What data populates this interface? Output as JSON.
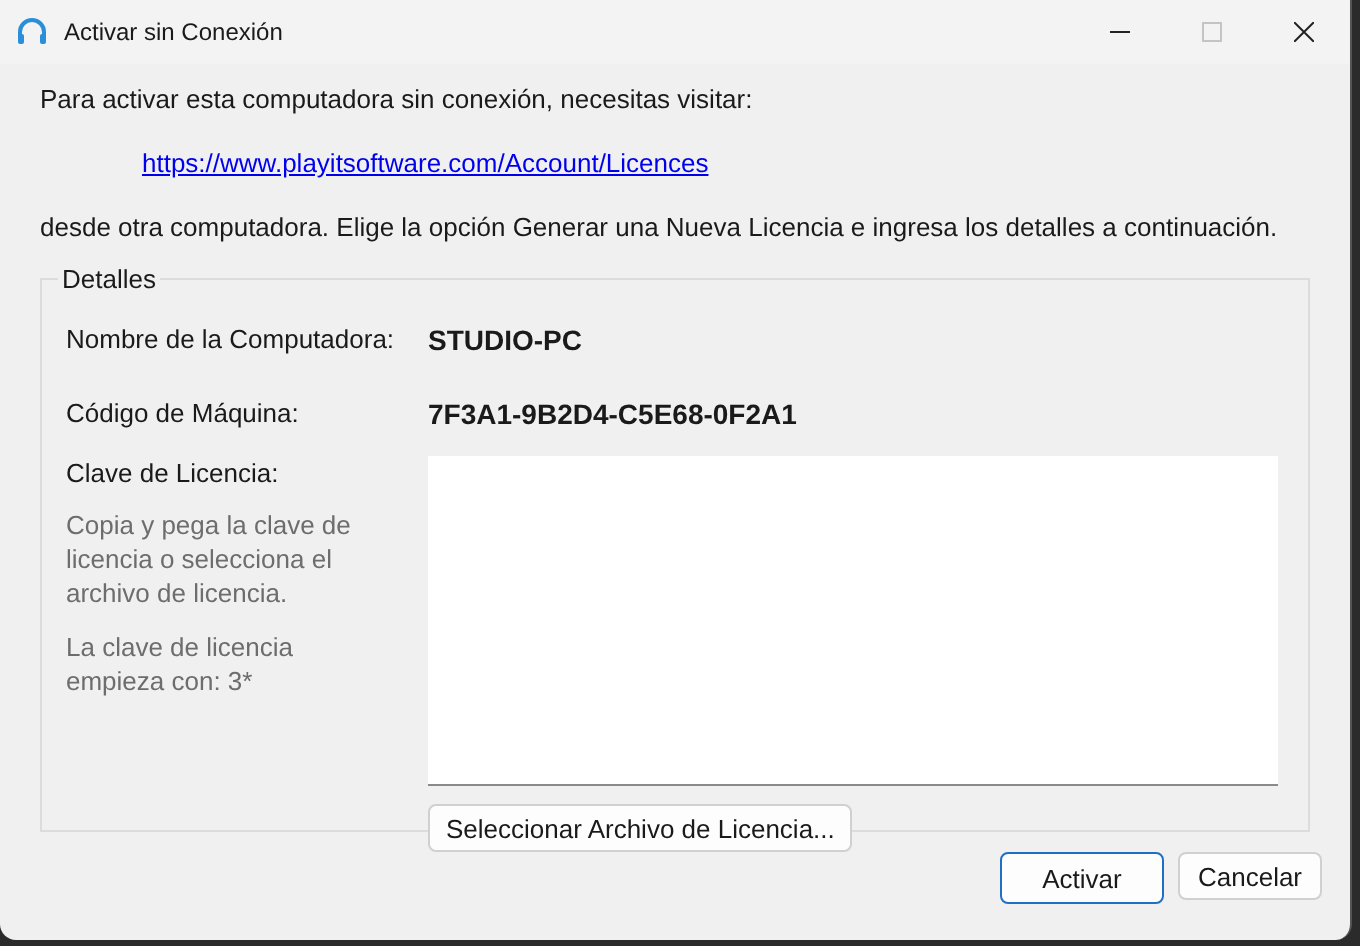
{
  "window": {
    "title": "Activar sin Conexión",
    "maximize_disabled": true
  },
  "intro": "Para activar esta computadora sin conexión, necesitas visitar:",
  "link": "https://www.playitsoftware.com/Account/Licences",
  "instructions": "desde otra computadora. Elige la opción Generar una Nueva Licencia e ingresa los detalles a continuación.",
  "details": {
    "title": "Detalles",
    "fields": [
      {
        "label": "Nombre de la Computadora:",
        "value": "STUDIO-PC"
      },
      {
        "label": "Código de Máquina:",
        "value": "7F3A1-9B2D4-C5E68-0F2A1"
      }
    ],
    "license_label": "Clave de Licencia:",
    "hints": [
      "Copia y pega la clave de licencia o selecciona el archivo de licencia.",
      "La clave de licencia empieza con: 3*"
    ],
    "select_button": "Seleccionar Archivo de Licencia..."
  },
  "buttons": [
    {
      "label": "Activar",
      "default": true
    },
    {
      "label": "Cancelar",
      "default": false
    }
  ]
}
